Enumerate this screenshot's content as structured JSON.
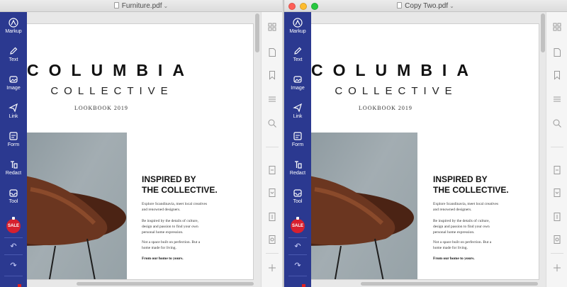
{
  "windows": [
    {
      "id": "left",
      "title": "Furniture.pdf",
      "show_lights": false
    },
    {
      "id": "right",
      "title": "Copy Two.pdf",
      "show_lights": true
    }
  ],
  "lights_colors": [
    "#ff5f57",
    "#febc2e",
    "#28c840"
  ],
  "sidebar": {
    "color": "#2b3990",
    "tools": [
      {
        "label": "Markup",
        "icon": "markup-icon"
      },
      {
        "label": "Text",
        "icon": "text-pencil-icon"
      },
      {
        "label": "Image",
        "icon": "image-icon"
      },
      {
        "label": "Link",
        "icon": "link-arrow-icon"
      },
      {
        "label": "Form",
        "icon": "form-icon"
      },
      {
        "label": "Redact",
        "icon": "redact-icon"
      },
      {
        "label": "Tool",
        "icon": "tool-tray-icon"
      }
    ],
    "sale_badge": "SALE",
    "undo_icon": "undo-icon",
    "redo_icon": "redo-icon"
  },
  "document": {
    "brand": "COLUMBIA",
    "subtitle": "COLLECTIVE",
    "lookbook": "LOOKBOOK 2019",
    "headline_line1": "INSPIRED BY",
    "headline_line2": "THE COLLECTIVE.",
    "para1_line1": "Explore Scandinavia, meet local creatives",
    "para1_line2": "and renowned designers.",
    "para2_line1": "Be inspired by the details of culture,",
    "para2_line2": "design and passion to find your own",
    "para2_line3": "personal home expression.",
    "para3_line1": "Not a space built on perfection. But a",
    "para3_line2": "home made for living.",
    "para4": "From our home to yours."
  },
  "rail_icons": [
    "thumbnails-icon",
    "page-icon",
    "bookmark-icon",
    "outline-icon",
    "search-icon",
    "convert-icon",
    "compress-icon",
    "extract-icon",
    "organize-icon",
    "add-icon"
  ]
}
